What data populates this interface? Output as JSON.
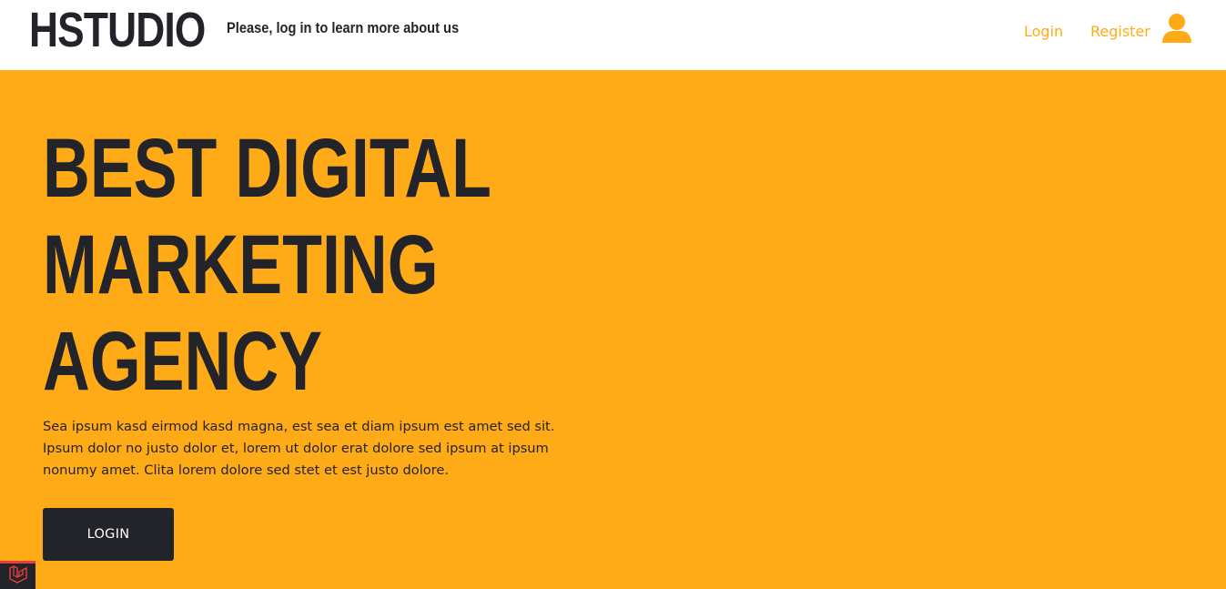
{
  "navbar": {
    "brand": "HSTUDIO",
    "tagline": "Please, log in to learn more about us",
    "links": [
      {
        "label": "Login"
      },
      {
        "label": "Register"
      }
    ],
    "user_icon": "user-icon"
  },
  "hero": {
    "title_lines": [
      "BEST DIGITAL",
      "MARKETING",
      "AGENCY"
    ],
    "paragraph": "Sea ipsum kasd eirmod kasd magna, est sea et diam ipsum est amet sed sit. Ipsum dolor no justo dolor et, lorem ut dolor erat dolore sed ipsum at ipsum nonumy amet. Clita lorem dolore sed stet et est justo dolore.",
    "button_label": "LOGIN"
  },
  "debug_badge": {
    "icon": "laravel-logo-icon"
  },
  "colors": {
    "accent": "#ffaa17",
    "dark": "#232429",
    "white": "#ffffff",
    "badge_red": "#e83e3e"
  }
}
